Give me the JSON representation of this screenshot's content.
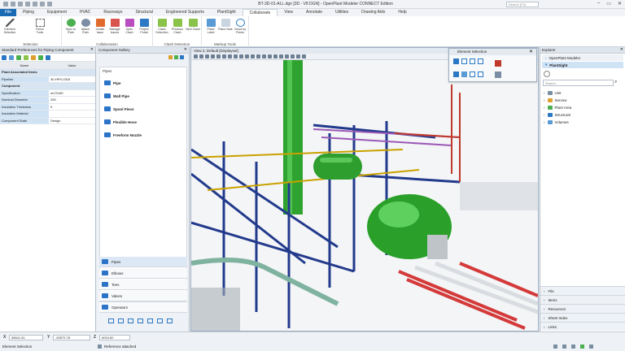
{
  "window": {
    "title": "BT-3D-01-ALL.dgn [3D - V8 DGN] - OpenPlant Modeler CONNECT Edition",
    "search_placeholder": "Search (F4)"
  },
  "tabs": {
    "file": "File",
    "items": [
      "Piping",
      "Equipment",
      "HVAC",
      "Raceways",
      "Structural",
      "Engineered Supports",
      "PlantSight",
      "Collaborate",
      "View",
      "Annotate",
      "Utilities",
      "Drawing Aids",
      "Help"
    ],
    "active": "Collaborate"
  },
  "ribbon": {
    "groups": [
      {
        "label": "Selection",
        "buttons": [
          "Element Selection",
          "Fence Tools"
        ]
      },
      {
        "label": "Collaboration",
        "buttons": [
          "Sync to iTwin",
          "Attach iTwin",
          "Create Issue",
          "Manage Issues",
          "Open Clash",
          "Project Portal"
        ]
      },
      {
        "label": "Clash Detection",
        "buttons": [
          "Clash Detection",
          "Previous Clash",
          "Next Clash"
        ]
      },
      {
        "label": "Markup Tools",
        "buttons": [
          "Place Label",
          "Place Note",
          "Cloud by Points"
        ]
      }
    ]
  },
  "prefs": {
    "title": "Standard Preferences for Piping Component",
    "col_name": "Name",
    "col_value": "Value",
    "sec1": "Plant Associated Items",
    "pipeline_key": "Pipeline",
    "pipeline_val": "30-HPS-0316",
    "sec2": "Component",
    "rows": [
      {
        "k": "Specification",
        "v": "mCS150"
      },
      {
        "k": "Nominal Diameter",
        "v": "250"
      },
      {
        "k": "Insulation Thickness",
        "v": "0"
      },
      {
        "k": "Insulation Material",
        "v": ""
      },
      {
        "k": "Component State",
        "v": "Design"
      }
    ]
  },
  "gallery": {
    "title": "Component Gallery",
    "section": "Pipes",
    "items": [
      "Pipe",
      "Wall Pipe",
      "Spool Piece",
      "Flexible Hose",
      "Freeform Nozzle"
    ],
    "categories": [
      "Pipes",
      "Elbows",
      "Tees",
      "Valves",
      "Operators"
    ]
  },
  "view": {
    "title": "View 2, Default [Displayset]"
  },
  "element_selection": {
    "title": "Element Selection"
  },
  "explorer": {
    "title": "Explorer",
    "modeler": "OpenPlant Modeler",
    "plantsight": "PlantSight",
    "search_placeholder": "Search",
    "tree": [
      "Unit",
      "Service",
      "Plant Area",
      "Structural",
      "Volumes"
    ],
    "bottom": [
      "File",
      "Items",
      "Resources",
      "Sheet Index",
      "Links"
    ]
  },
  "status": {
    "x_label": "X",
    "x_val": "58641.81",
    "y_label": "Y",
    "y_val": "-63579.78",
    "z_label": "Z",
    "z_val": "6004.60",
    "mode": "Element Selection",
    "message": "Reference attached"
  }
}
